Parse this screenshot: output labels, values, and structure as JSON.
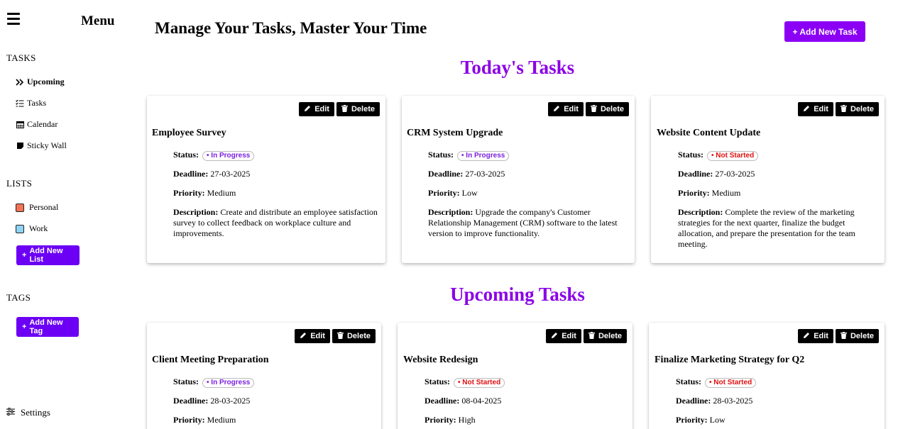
{
  "sidebar": {
    "menu_title": "Menu",
    "tasks_section": "TASKS",
    "nav": [
      {
        "label": "Upcoming",
        "icon": "double-chevron-icon"
      },
      {
        "label": "Tasks",
        "icon": "checklist-icon"
      },
      {
        "label": "Calendar",
        "icon": "calendar-icon"
      },
      {
        "label": "Sticky Wall",
        "icon": "sticky-note-icon"
      }
    ],
    "lists_section": "LISTS",
    "lists": [
      {
        "label": "Personal",
        "color": "#f27356"
      },
      {
        "label": "Work",
        "color": "#8fd3f5"
      }
    ],
    "add_list_label": "Add New List",
    "tags_section": "TAGS",
    "add_tag_label": "Add New Tag",
    "settings_label": "Settings"
  },
  "header": {
    "title": "Manage Your Tasks, Master Your Time",
    "add_task_label": "+ Add New Task"
  },
  "labels": {
    "edit": "Edit",
    "delete": "Delete",
    "status": "Status:",
    "deadline": "Deadline:",
    "priority": "Priority:",
    "description": "Description:"
  },
  "today": {
    "heading": "Today's Tasks",
    "tasks": [
      {
        "title": "Employee Survey",
        "status": "• In Progress",
        "deadline": "27-03-2025",
        "priority": "Medium",
        "description": "Create and distribute an employee satisfaction survey to collect feedback on workplace culture and improvements."
      },
      {
        "title": "CRM System Upgrade",
        "status": "• In Progress",
        "deadline": "27-03-2025",
        "priority": "Low",
        "description": "Upgrade the company's Customer Relationship Management (CRM) software to the latest version to improve functionality."
      },
      {
        "title": "Website Content Update",
        "status": "• Not Started",
        "deadline": "27-03-2025",
        "priority": "Medium",
        "description": "Complete the review of the marketing strategies for the next quarter, finalize the budget allocation, and prepare the presentation for the team meeting."
      }
    ]
  },
  "upcoming": {
    "heading": "Upcoming Tasks",
    "tasks": [
      {
        "title": "Client Meeting Preparation",
        "status": "• In Progress",
        "deadline": "28-03-2025",
        "priority": "Medium"
      },
      {
        "title": "Website Redesign",
        "status": "• Not Started",
        "deadline": "08-04-2025",
        "priority": "High"
      },
      {
        "title": "Finalize Marketing Strategy for Q2",
        "status": "• Not Started",
        "deadline": "28-03-2025",
        "priority": "Low"
      }
    ]
  },
  "colors": {
    "accent": "#6b00f5",
    "heading": "#8b00e6",
    "in_progress": "#7a1fe0",
    "not_started": "#e01010"
  }
}
